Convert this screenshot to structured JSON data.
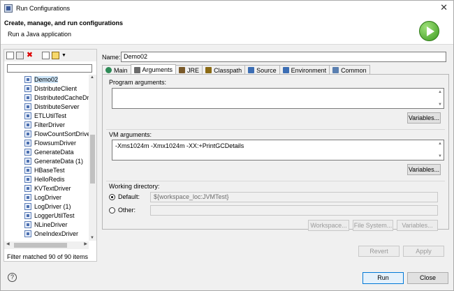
{
  "window": {
    "title": "Run Configurations",
    "close_glyph": "✕"
  },
  "header": {
    "title": "Create, manage, and run configurations",
    "subtitle": "Run a Java application"
  },
  "sidebar": {
    "filter_placeholder": "",
    "items": [
      {
        "label": "Demo02",
        "selected": true
      },
      {
        "label": "DistributeClient"
      },
      {
        "label": "DistributedCacheDri"
      },
      {
        "label": "DistributeServer"
      },
      {
        "label": "ETLUtilTest"
      },
      {
        "label": "FilterDriver"
      },
      {
        "label": "FlowCountSortDrive"
      },
      {
        "label": "FlowsumDriver"
      },
      {
        "label": "GenerateData"
      },
      {
        "label": "GenerateData (1)"
      },
      {
        "label": "HBaseTest"
      },
      {
        "label": "HelloRedis"
      },
      {
        "label": "KVTextDriver"
      },
      {
        "label": "LogDriver"
      },
      {
        "label": "LogDriver (1)"
      },
      {
        "label": "LoggerUtilTest"
      },
      {
        "label": "NLineDriver"
      },
      {
        "label": "OneIndexDriver"
      }
    ],
    "filter_status": "Filter matched 90 of 90 items"
  },
  "config": {
    "name_label": "Name:",
    "name_value": "Demo02",
    "tabs": [
      {
        "label": "Main",
        "icon": "main-tab-icon"
      },
      {
        "label": "Arguments",
        "icon": "arguments-tab-icon",
        "active": true
      },
      {
        "label": "JRE",
        "icon": "jre-tab-icon"
      },
      {
        "label": "Classpath",
        "icon": "classpath-tab-icon"
      },
      {
        "label": "Source",
        "icon": "source-tab-icon"
      },
      {
        "label": "Environment",
        "icon": "environment-tab-icon"
      },
      {
        "label": "Common",
        "icon": "common-tab-icon"
      }
    ],
    "program_args_label": "Program arguments:",
    "program_args_value": "",
    "program_vars_button": "Variables...",
    "vm_args_label": "VM arguments:",
    "vm_args_value": "-Xms1024m -Xmx1024m -XX:+PrintGCDetails",
    "vm_vars_button": "Variables...",
    "working_dir_label": "Working directory:",
    "default_label": "Default:",
    "default_value": "${workspace_loc:JVMTest}",
    "other_label": "Other:",
    "other_value": "",
    "workspace_button": "Workspace...",
    "filesystem_button": "File System...",
    "wd_variables_button": "Variables...",
    "revert_button": "Revert",
    "apply_button": "Apply"
  },
  "footer": {
    "run_button": "Run",
    "close_button": "Close",
    "help_glyph": "?"
  }
}
